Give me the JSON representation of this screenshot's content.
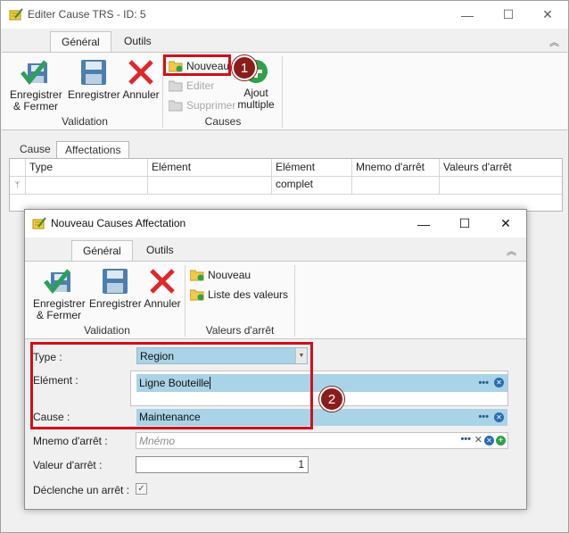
{
  "main_window": {
    "title": "Editer Cause TRS - ID: 5",
    "tabs": [
      {
        "label": "Général"
      },
      {
        "label": "Outils"
      }
    ],
    "validation": {
      "save_close": "Enregistrer & Fermer",
      "save": "Enregistrer",
      "cancel": "Annuler",
      "group_label": "Validation"
    },
    "causes": {
      "new": "Nouveau",
      "edit": "Editer",
      "delete": "Supprimer",
      "add_multiple": "Ajout multiple",
      "group_label": "Causes"
    },
    "panel_tabs": [
      {
        "label": "Cause"
      },
      {
        "label": "Affectations"
      }
    ],
    "grid_columns": [
      "Type",
      "Elément",
      "Elément complet",
      "Mnemo d'arrêt",
      "Valeurs d'arrêt"
    ]
  },
  "dialog": {
    "title": "Nouveau Causes Affectation",
    "tabs": [
      {
        "label": "Général"
      },
      {
        "label": "Outils"
      }
    ],
    "validation": {
      "save_close": "Enregistrer & Fermer",
      "save": "Enregistrer",
      "cancel": "Annuler",
      "group_label": "Validation"
    },
    "stop_values": {
      "new": "Nouveau",
      "list": "Liste des valeurs",
      "group_label": "Valeurs d'arrêt"
    },
    "form": {
      "type_label": "Type :",
      "type_value": "Region",
      "element_label": "Elément :",
      "element_value": "Ligne Bouteille",
      "cause_label": "Cause :",
      "cause_value": "Maintenance",
      "mnemo_label": "Mnemo d'arrêt :",
      "mnemo_placeholder": "Mnémo",
      "stop_value_label": "Valeur d'arrêt :",
      "stop_value": "1",
      "trigger_label": "Déclenche un arrêt :",
      "trigger_checked": true
    }
  },
  "annotations": {
    "badge1": "1",
    "badge2": "2"
  },
  "colors": {
    "callout": "#d0101a",
    "badge": "#8b1c1c",
    "field_highlight": "#a9d3e6"
  }
}
